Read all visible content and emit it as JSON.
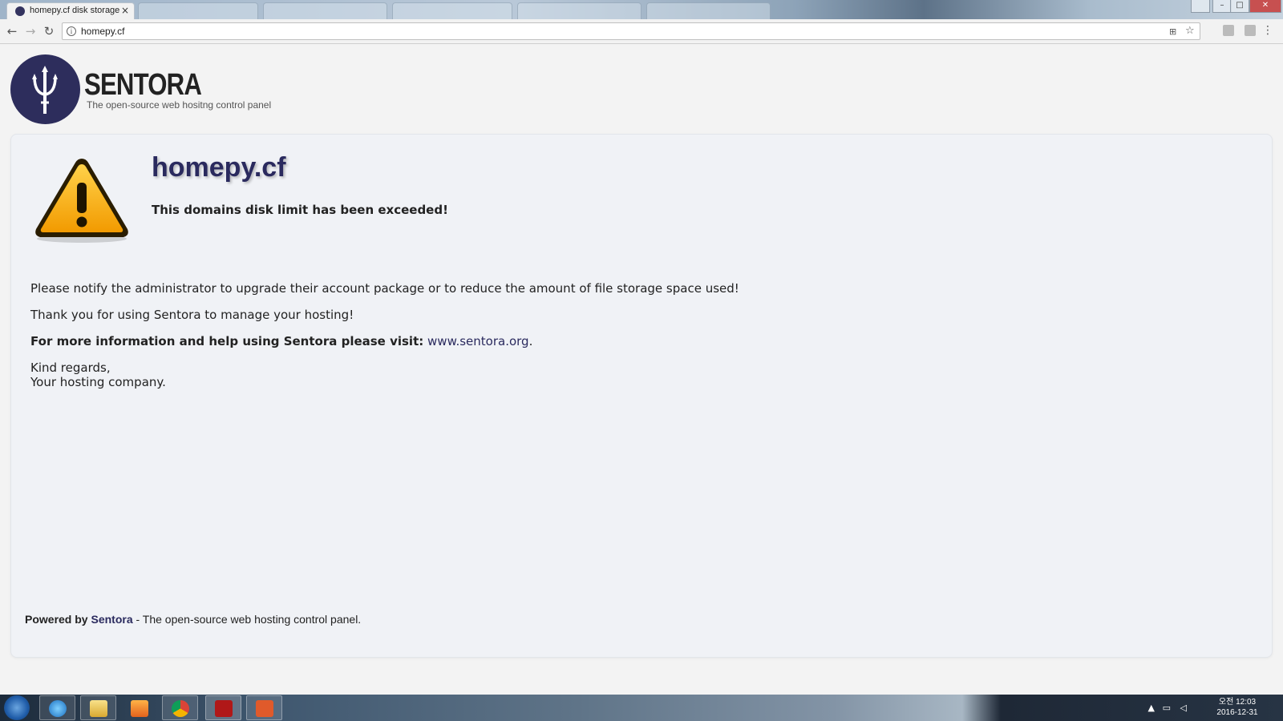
{
  "browser": {
    "active_tab_title": "homepy.cf disk storage",
    "tab_close": "×",
    "background_tabs": [
      "",
      "",
      "",
      "",
      ""
    ],
    "url": "homepy.cf",
    "info_glyph": "i",
    "translate_glyph": "⊞",
    "bookmark_glyph": "☆",
    "menu_glyph": "⋮",
    "back_glyph": "←",
    "forward_glyph": "→",
    "reload_glyph": "↻",
    "window_controls": {
      "minimize": "–",
      "maximize": "□",
      "close": "✕"
    }
  },
  "header": {
    "brand": "SENTORA",
    "tagline": "The open-source web hositng control panel"
  },
  "notice": {
    "domain": "homepy.cf",
    "headline": "This domains disk limit has been exceeded!",
    "line1": "Please notify the administrator to upgrade their account package or to reduce the amount of file storage space used!",
    "line2": "Thank you for using Sentora to manage your hosting!",
    "info_label": "For more information and help using Sentora please visit:",
    "info_link": "www.sentora.org",
    "info_suffix": ".",
    "regards1": "Kind regards,",
    "regards2": "Your hosting company."
  },
  "footer": {
    "powered_by": "Powered by",
    "brand": "Sentora",
    "rest": " - The open-source web hosting control panel."
  },
  "taskbar": {
    "items": [
      "internet-explorer",
      "file-explorer",
      "media-player",
      "chrome",
      "filezilla",
      "powerpoint"
    ],
    "time": "오전 12:03",
    "date": "2016-12-31"
  },
  "colors": {
    "brand_navy": "#2d2d5c",
    "warning_orange": "#f5a200",
    "panel_bg": "#f0f2f6"
  }
}
